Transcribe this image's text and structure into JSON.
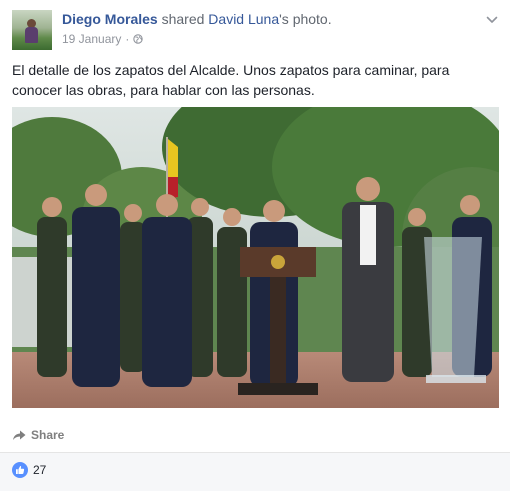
{
  "post": {
    "actor_name": "Diego Morales",
    "action_text": " shared ",
    "owner_name": "David Luna",
    "owner_suffix": "'s photo.",
    "date": "19 January",
    "separator": "·",
    "privacy_icon": "globe-icon",
    "options_icon": "chevron-down-icon",
    "text": "El detalle de los zapatos del Alcalde. Unos zapatos para caminar, para conocer las obras, para hablar con las personas."
  },
  "actions": {
    "share_label": "Share",
    "share_icon": "share-arrow-icon"
  },
  "reactions": {
    "like_icon": "thumbs-up-icon",
    "count": "27"
  },
  "colors": {
    "link_blue": "#365899",
    "meta_gray": "#90949c",
    "like_blue": "#5890ff",
    "footer_bg": "#f6f7f9"
  }
}
